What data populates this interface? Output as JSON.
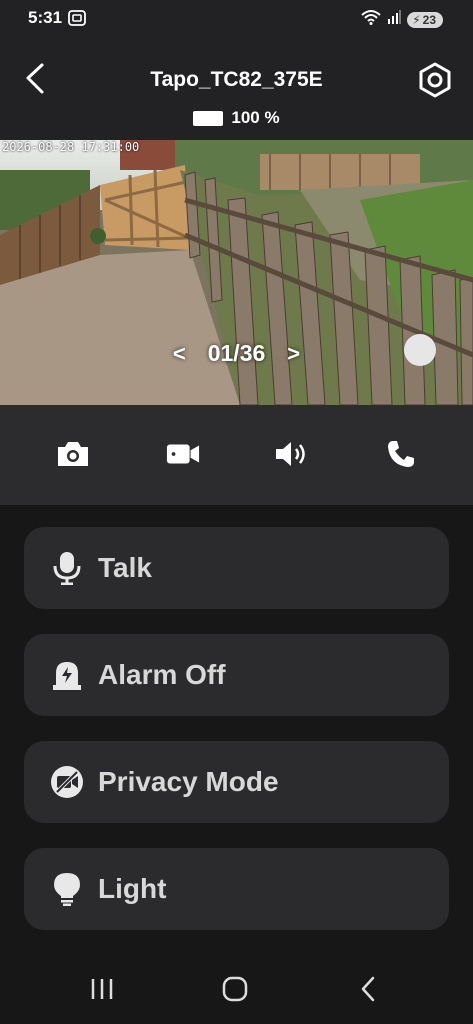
{
  "status_bar": {
    "time": "5:31",
    "battery_level": "23"
  },
  "header": {
    "title": "Tapo_TC82_375E",
    "camera_battery": "100 %"
  },
  "video": {
    "timestamp": "2026-08-28 17:31:00",
    "counter": "01/36",
    "prev": "<",
    "next": ">"
  },
  "controls": [
    {
      "name": "snapshot",
      "icon": "camera-icon"
    },
    {
      "name": "record",
      "icon": "video-camera-icon"
    },
    {
      "name": "sound",
      "icon": "speaker-icon"
    },
    {
      "name": "call",
      "icon": "phone-icon"
    }
  ],
  "actions": [
    {
      "label": "Talk",
      "icon": "microphone-icon"
    },
    {
      "label": "Alarm Off",
      "icon": "siren-icon"
    },
    {
      "label": "Privacy Mode",
      "icon": "video-off-icon"
    },
    {
      "label": "Light",
      "icon": "lightbulb-icon"
    }
  ],
  "navigation": [
    {
      "name": "recents",
      "icon": "recents-icon"
    },
    {
      "name": "home",
      "icon": "home-icon"
    },
    {
      "name": "back",
      "icon": "back-icon"
    }
  ]
}
